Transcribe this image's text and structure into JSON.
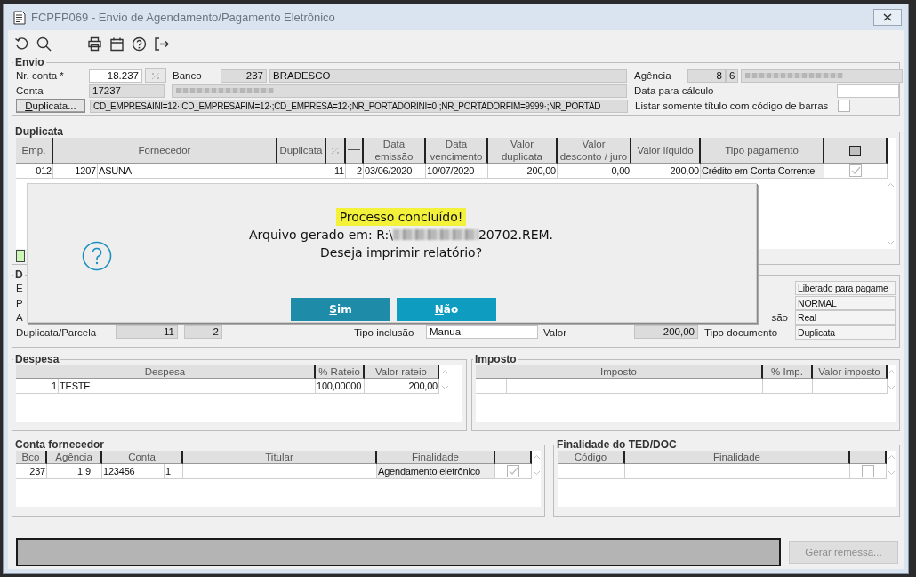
{
  "window": {
    "title": "FCPFP069 - Envio de Agendamento/Pagamento Eletrônico"
  },
  "toolbar": [
    {
      "kind": "undo"
    },
    {
      "kind": "search"
    },
    {
      "kind": "print"
    },
    {
      "kind": "calendar"
    },
    {
      "kind": "help"
    },
    {
      "kind": "exit"
    }
  ],
  "envio": {
    "legend": "Envio",
    "nr_conta_label": "Nr. conta *",
    "nr_conta": "18.237",
    "banco_label": "Banco",
    "banco_code": "237",
    "banco_name": "BRADESCO",
    "conta_label": "Conta",
    "conta": "17237",
    "duplicata_button": "Duplicata...",
    "filter": "CD_EMPRESAINI=12·;CD_EMPRESAFIM=12·;CD_EMPRESA=12·;NR_PORTADORINI=0·;NR_PORTADORFIM=9999·;NR_PORTAD",
    "agencia_label": "Agência",
    "agencia": "8",
    "agencia_digit": "6",
    "data_label": "Data para cálculo",
    "listar_label": "Listar somente título com código de barras",
    "listar_checked": false
  },
  "duplicata": {
    "legend": "Duplicata",
    "columns": [
      "Emp.",
      "Fornecedor",
      "Duplicata",
      "",
      "",
      "Data\nemissão",
      "Data\nvencimento",
      "Valor\nduplicata",
      "Valor\ndesconto / juro",
      "Valor líquido",
      "Tipo pagamento",
      ""
    ],
    "rows": [
      {
        "emp": "012",
        "fornecedor_code": "1207",
        "fornecedor": "ASUNA",
        "duplicata": "11",
        "parcela": "2",
        "emissao": "03/06/2020",
        "vencimento": "10/07/2020",
        "valor_duplicata": "200,00",
        "valor_desconto": "0,00",
        "valor_liquido": "200,00",
        "tipo_pagamento": "Crédito em Conta Corrente",
        "checked": true
      }
    ]
  },
  "detail": {
    "legend": "D",
    "labels": [
      "E",
      "P",
      "A"
    ],
    "label_right": "são",
    "values_right": [
      "Liberado para pagame",
      "NORMAL",
      "Real"
    ],
    "duplicata_parcela_label": "Duplicata/Parcela",
    "duplicata": "11",
    "parcela": "2",
    "tipo_inclusao_label": "Tipo inclusão",
    "tipo_inclusao": "Manual",
    "valor_label": "Valor",
    "valor": "200,00",
    "tipo_documento_label": "Tipo documento",
    "tipo_documento": "Duplicata"
  },
  "despesa": {
    "legend": "Despesa",
    "columns": [
      "Despesa",
      "% Rateio",
      "Valor rateio"
    ],
    "rows": [
      {
        "code": "1",
        "name": "TESTE",
        "rateio": "100,00000",
        "valor": "200,00"
      }
    ]
  },
  "imposto": {
    "legend": "Imposto",
    "columns": [
      "Imposto",
      "% Imp.",
      "Valor imposto"
    ]
  },
  "conta_fornecedor": {
    "legend": "Conta fornecedor",
    "columns": [
      "Bco",
      "Agência",
      "Conta",
      "Titular",
      "Finalidade",
      ""
    ],
    "rows": [
      {
        "bco": "237",
        "agencia": "1",
        "agencia_digit": "9",
        "conta": "123456",
        "conta_digit": "1",
        "finalidade": "Agendamento eletrônico",
        "checked": true
      }
    ]
  },
  "ted_doc": {
    "legend": "Finalidade do TED/DOC",
    "columns": [
      "Código",
      "Finalidade",
      ""
    ],
    "rows": [
      {
        "checked": false
      }
    ]
  },
  "gerar_button": {
    "label": "Gerar remessa...",
    "disabled": true
  },
  "dialog": {
    "headline": "Processo concluído!",
    "file_prefix": "Arquivo gerado em: R:\\",
    "file_suffix": "20702.REM.",
    "question": "Deseja imprimir relatório?",
    "buttons": [
      {
        "label": "Sim",
        "selected": true
      },
      {
        "label": "Não",
        "selected": false
      }
    ]
  }
}
